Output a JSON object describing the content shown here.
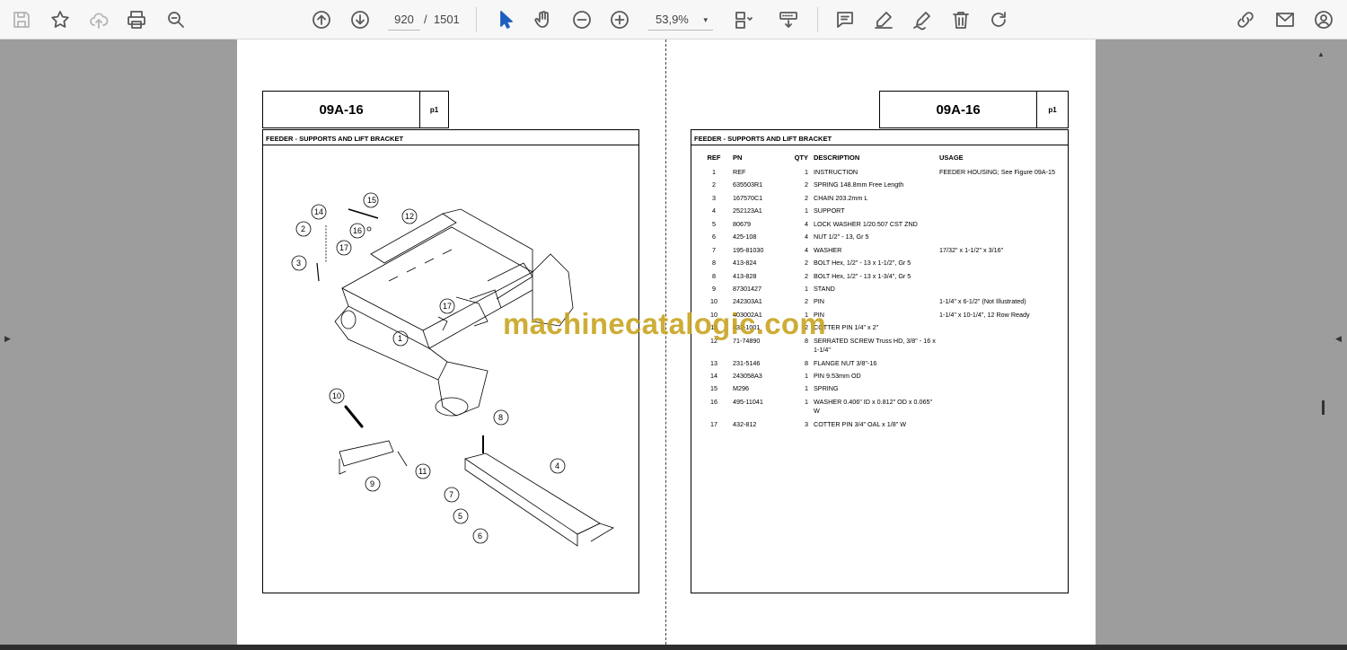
{
  "toolbar": {
    "page_current": "920",
    "page_separator": "/",
    "page_total": "1501",
    "zoom": "53,9%",
    "zoom_caret": "▾"
  },
  "left_page": {
    "header_title": "09A-16",
    "header_page": "p1",
    "subtitle": "FEEDER - SUPPORTS AND LIFT BRACKET",
    "callouts": [
      "15",
      "14",
      "12",
      "2",
      "16",
      "17",
      "3",
      "17",
      "1",
      "10",
      "8",
      "11",
      "9",
      "4",
      "7",
      "5",
      "6"
    ]
  },
  "right_page": {
    "header_title": "09A-16",
    "header_page": "p1",
    "subtitle": "FEEDER - SUPPORTS AND LIFT BRACKET",
    "columns": [
      "REF",
      "PN",
      "QTY",
      "DESCRIPTION",
      "USAGE"
    ],
    "rows": [
      {
        "ref": "1",
        "pn": "REF",
        "qty": "1",
        "desc": "INSTRUCTION",
        "usage": "FEEDER HOUSING; See Figure 09A-15"
      },
      {
        "ref": "2",
        "pn": "635503R1",
        "qty": "2",
        "desc": "SPRING 148.8mm Free Length",
        "usage": ""
      },
      {
        "ref": "3",
        "pn": "167570C1",
        "qty": "2",
        "desc": "CHAIN 203.2mm L",
        "usage": ""
      },
      {
        "ref": "4",
        "pn": "252123A1",
        "qty": "1",
        "desc": "SUPPORT",
        "usage": ""
      },
      {
        "ref": "5",
        "pn": "80679",
        "qty": "4",
        "desc": "LOCK WASHER 1/20.507 CST ZND",
        "usage": ""
      },
      {
        "ref": "6",
        "pn": "425-108",
        "qty": "4",
        "desc": "NUT 1/2\" - 13, Gr 5",
        "usage": ""
      },
      {
        "ref": "7",
        "pn": "195-81030",
        "qty": "4",
        "desc": "WASHER",
        "usage": "17/32\" x 1-1/2\" x 3/16\""
      },
      {
        "ref": "8",
        "pn": "413-824",
        "qty": "2",
        "desc": "BOLT Hex, 1/2\" - 13 x 1-1/2\", Gr 5",
        "usage": ""
      },
      {
        "ref": "8",
        "pn": "413-828",
        "qty": "2",
        "desc": "BOLT Hex, 1/2\" - 13 x 1-3/4\", Gr 5",
        "usage": ""
      },
      {
        "ref": "9",
        "pn": "87301427",
        "qty": "1",
        "desc": "STAND",
        "usage": ""
      },
      {
        "ref": "10",
        "pn": "242303A1",
        "qty": "2",
        "desc": "PIN",
        "usage": "1-1/4\" x 6-1/2\" (Not Illustrated)"
      },
      {
        "ref": "10",
        "pn": "403002A1",
        "qty": "1",
        "desc": "PIN",
        "usage": "1-1/4\" x 10-1/4\", 12 Row Ready"
      },
      {
        "ref": "11",
        "pn": "432-1001",
        "qty": "2",
        "desc": "COTTER PIN 1/4\" x 2\"",
        "usage": ""
      },
      {
        "ref": "12",
        "pn": "71-74890",
        "qty": "8",
        "desc": "SERRATED SCREW Truss HD, 3/8\" - 16 x 1-1/4\"",
        "usage": ""
      },
      {
        "ref": "13",
        "pn": "231-5146",
        "qty": "8",
        "desc": "FLANGE NUT 3/8\"-16",
        "usage": ""
      },
      {
        "ref": "14",
        "pn": "243058A3",
        "qty": "1",
        "desc": "PIN 9.53mm OD",
        "usage": ""
      },
      {
        "ref": "15",
        "pn": "M296",
        "qty": "1",
        "desc": "SPRING",
        "usage": ""
      },
      {
        "ref": "16",
        "pn": "495-11041",
        "qty": "1",
        "desc": "WASHER 0.406\" ID x 0.812\" OD x 0.065\" W",
        "usage": ""
      },
      {
        "ref": "17",
        "pn": "432-812",
        "qty": "3",
        "desc": "COTTER PIN 3/4\" OAL x 1/8\" W",
        "usage": ""
      }
    ]
  },
  "watermark": "machinecatalogic.com"
}
